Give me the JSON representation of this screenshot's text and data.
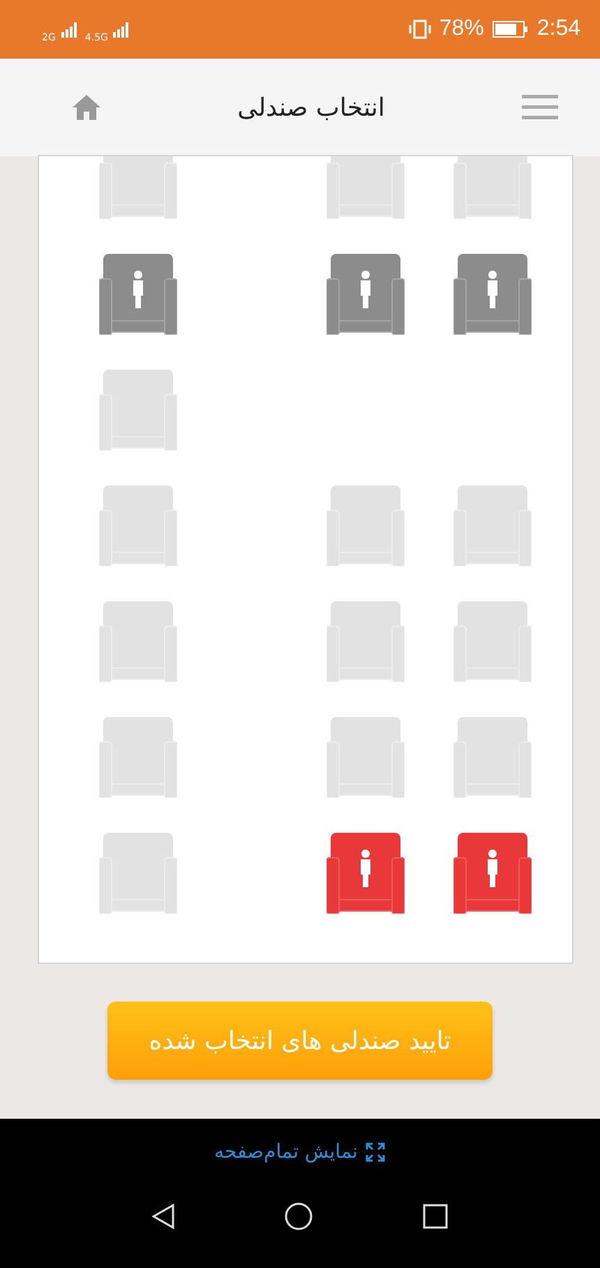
{
  "status_bar": {
    "signal_1": "2G",
    "signal_2": "4.5G",
    "battery": "78%",
    "time": "2:54"
  },
  "header": {
    "title": "انتخاب صندلی"
  },
  "rows": [
    {
      "seats": [
        {
          "kind": "seat",
          "occupied": false,
          "selected": false
        },
        {
          "kind": "seat",
          "occupied": false,
          "selected": false
        },
        {
          "kind": "seat",
          "occupied": false,
          "selected": false
        }
      ]
    },
    {
      "seats": [
        {
          "kind": "seat",
          "occupied": true,
          "selected": false
        },
        {
          "kind": "seat",
          "occupied": true,
          "selected": false
        },
        {
          "kind": "seat",
          "occupied": true,
          "selected": false
        }
      ]
    },
    {
      "seats": [
        {
          "kind": "seat",
          "occupied": false,
          "selected": false
        },
        {
          "kind": "gap"
        },
        {
          "kind": "gap"
        }
      ]
    },
    {
      "seats": [
        {
          "kind": "seat",
          "occupied": false,
          "selected": false
        },
        {
          "kind": "seat",
          "occupied": false,
          "selected": false
        },
        {
          "kind": "seat",
          "occupied": false,
          "selected": false
        }
      ]
    },
    {
      "seats": [
        {
          "kind": "seat",
          "occupied": false,
          "selected": false
        },
        {
          "kind": "seat",
          "occupied": false,
          "selected": false
        },
        {
          "kind": "seat",
          "occupied": false,
          "selected": false
        }
      ]
    },
    {
      "seats": [
        {
          "kind": "seat",
          "occupied": false,
          "selected": false
        },
        {
          "kind": "seat",
          "occupied": false,
          "selected": false
        },
        {
          "kind": "seat",
          "occupied": false,
          "selected": false
        }
      ]
    },
    {
      "seats": [
        {
          "kind": "seat",
          "occupied": false,
          "selected": false
        },
        {
          "kind": "seat",
          "occupied": false,
          "selected": true
        },
        {
          "kind": "seat",
          "occupied": false,
          "selected": true
        }
      ]
    }
  ],
  "confirm_button": "تایید صندلی های انتخاب شده",
  "fullscreen_link": "نمایش تمام‌صفحه"
}
